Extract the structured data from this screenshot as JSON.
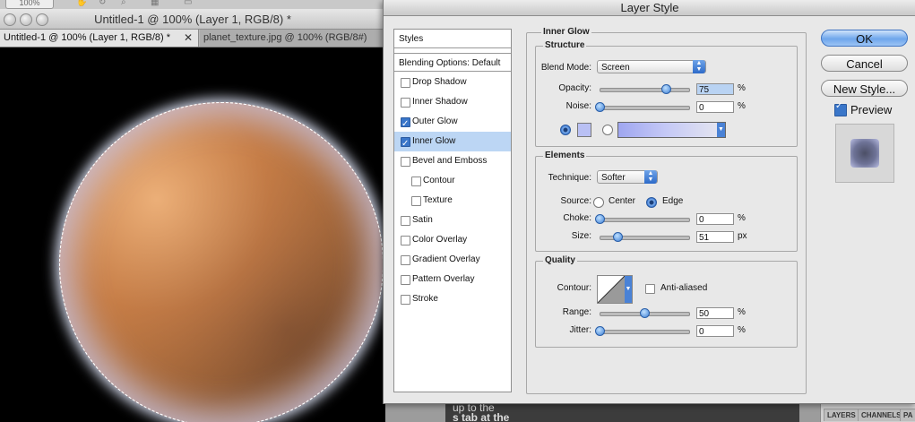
{
  "document": {
    "zoom_label": "100%",
    "title": "Untitled-1 @ 100% (Layer 1, RGB/8) *",
    "tabs": [
      {
        "label": "Untitled-1 @ 100% (Layer 1, RGB/8) *",
        "close": "✕"
      },
      {
        "label": "planet_texture.jpg @ 100% (RGB/8#)"
      }
    ]
  },
  "background": {
    "tutorial_line1": "up to the",
    "tutorial_line2": "s tab at the",
    "panel_tabs": [
      "LAYERS",
      "CHANNELS",
      "PA"
    ]
  },
  "dialog": {
    "title": "Layer Style",
    "styles_header": "Styles",
    "blending_options": "Blending Options: Default",
    "style_items": [
      {
        "label": "Drop Shadow",
        "checked": false
      },
      {
        "label": "Inner Shadow",
        "checked": false
      },
      {
        "label": "Outer Glow",
        "checked": true
      },
      {
        "label": "Inner Glow",
        "checked": true,
        "selected": true
      },
      {
        "label": "Bevel and Emboss",
        "checked": false
      },
      {
        "label": "Contour",
        "checked": false
      },
      {
        "label": "Texture",
        "checked": false
      },
      {
        "label": "Satin",
        "checked": false
      },
      {
        "label": "Color Overlay",
        "checked": false
      },
      {
        "label": "Gradient Overlay",
        "checked": false
      },
      {
        "label": "Pattern Overlay",
        "checked": false
      },
      {
        "label": "Stroke",
        "checked": false
      }
    ],
    "panel_title": "Inner Glow",
    "structure": {
      "label": "Structure",
      "blend_mode_label": "Blend Mode:",
      "blend_mode": "Screen",
      "opacity_label": "Opacity:",
      "opacity": "75",
      "opacity_fraction": 0.75,
      "noise_label": "Noise:",
      "noise": "0",
      "noise_fraction": 0,
      "percent": "%",
      "glow_color": "#b9c0f4"
    },
    "elements": {
      "label": "Elements",
      "technique_label": "Technique:",
      "technique": "Softer",
      "source_label": "Source:",
      "source_center": "Center",
      "source_edge": "Edge",
      "choke_label": "Choke:",
      "choke": "0",
      "choke_fraction": 0,
      "size_label": "Size:",
      "size": "51",
      "size_fraction": 0.2,
      "size_unit": "px",
      "percent": "%"
    },
    "quality": {
      "label": "Quality",
      "contour_label": "Contour:",
      "anti_aliased": "Anti-aliased",
      "range_label": "Range:",
      "range": "50",
      "range_fraction": 0.5,
      "jitter_label": "Jitter:",
      "jitter": "0",
      "jitter_fraction": 0,
      "percent": "%"
    },
    "buttons": {
      "ok": "OK",
      "cancel": "Cancel",
      "new_style": "New Style...",
      "preview": "Preview"
    }
  }
}
